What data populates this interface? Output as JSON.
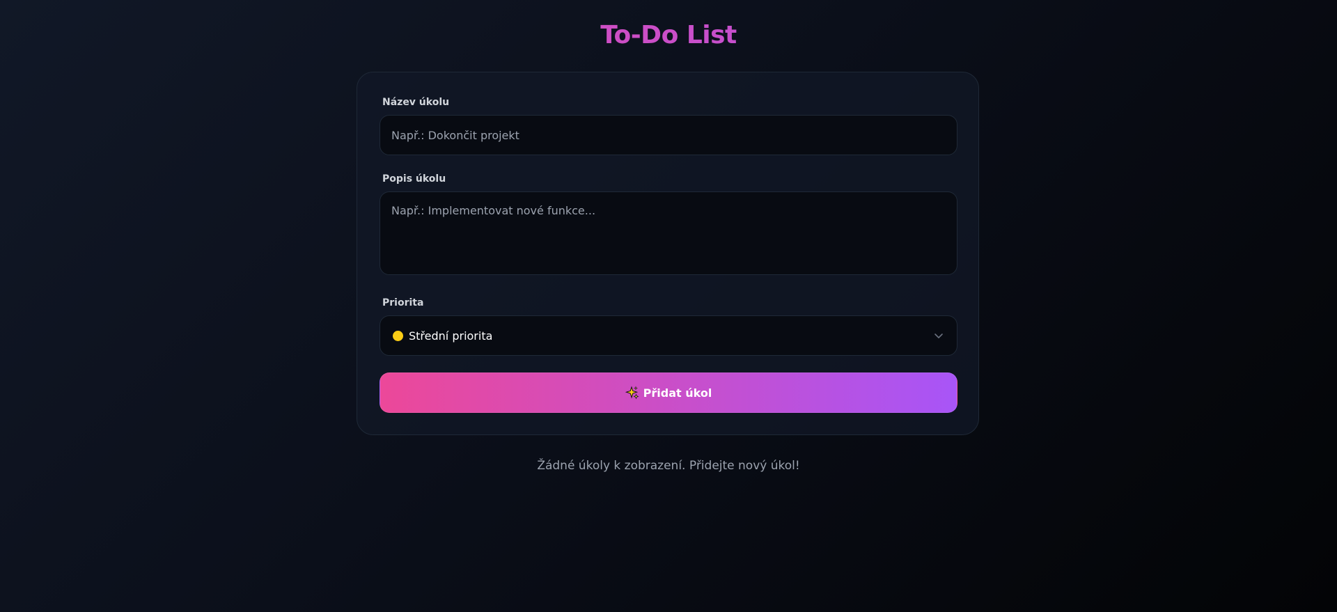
{
  "header": {
    "title": "To-Do List"
  },
  "form": {
    "title_label": "Název úkolu",
    "title_placeholder": "Např.: Dokončit projekt",
    "title_value": "",
    "description_label": "Popis úkolu",
    "description_placeholder": "Např.: Implementovat nové funkce...",
    "description_value": "",
    "priority_label": "Priorita",
    "priority_selected": "Střední priorita",
    "priority_color": "#facc15",
    "submit_label": "Přidat úkol",
    "submit_icon": "sparkles-icon"
  },
  "tasks": {
    "empty_message": "Žádné úkoly k zobrazení. Přidejte nový úkol!"
  },
  "theme": {
    "accent_start": "#ec4899",
    "accent_end": "#a855f7",
    "background": "#0b0f1a"
  }
}
